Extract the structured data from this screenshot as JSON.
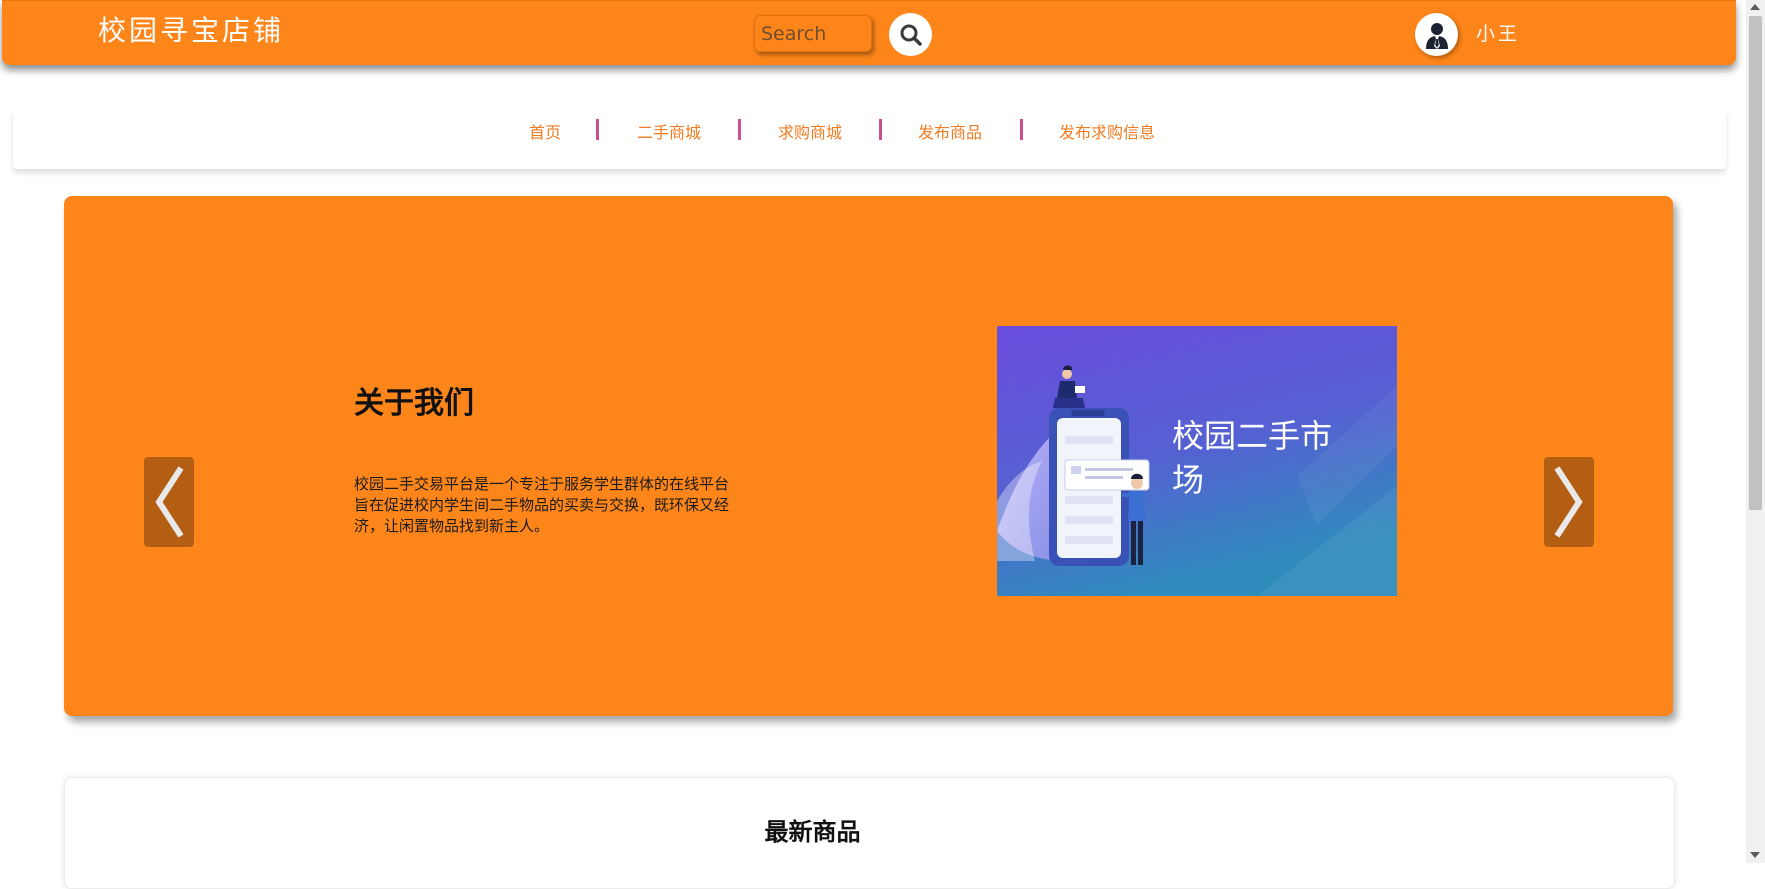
{
  "header": {
    "brand": "校园寻宝店铺",
    "search": {
      "placeholder": "Search",
      "value": ""
    },
    "user_name": "小王"
  },
  "nav": {
    "items": [
      {
        "label": "首页"
      },
      {
        "label": "二手商城"
      },
      {
        "label": "求购商城"
      },
      {
        "label": "发布商品"
      },
      {
        "label": "发布求购信息"
      }
    ]
  },
  "hero": {
    "title": "关于我们",
    "description": "校园二手交易平台是一个专注于服务学生群体的在线平台 旨在促进校内学生间二手物品的买卖与交换，既环保又经济，让闲置物品找到新主人。",
    "image_caption": "校园二手市场"
  },
  "latest": {
    "title": "最新商品"
  },
  "colors": {
    "accent": "#fd8519",
    "nav_text": "#f07b22",
    "nav_separator": "#c94f8e",
    "arrow_bg": "#b35e12"
  },
  "icons": {
    "search": "search-icon",
    "avatar": "user-avatar-icon",
    "prev": "chevron-left-icon",
    "next": "chevron-right-icon"
  }
}
